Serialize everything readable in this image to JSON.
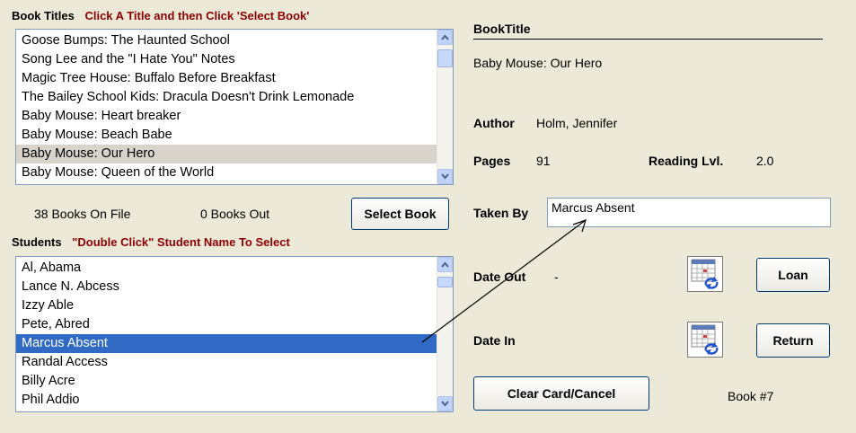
{
  "book_titles": {
    "heading": "Book Titles",
    "instruction": "Click A Title and then Click 'Select Book'",
    "items": [
      "Goose Bumps: The Haunted School",
      "Song Lee and the \"I Hate You\" Notes",
      "Magic Tree House: Buffalo Before Breakfast",
      "The Bailey School Kids: Dracula Doesn't Drink Lemonade",
      "Baby Mouse: Heart breaker",
      "Baby Mouse: Beach Babe",
      "Baby Mouse: Our Hero",
      "Baby Mouse: Queen of the World"
    ],
    "selected_index": 6
  },
  "counts": {
    "books_on_file": "38 Books On File",
    "books_out": "0 Books Out"
  },
  "select_book_label": "Select Book",
  "students": {
    "heading": "Students",
    "instruction": "\"Double Click\" Student Name To Select",
    "items": [
      "Al, Abama",
      "Lance N. Abcess",
      "Izzy Able",
      "Pete, Abred",
      "Marcus Absent",
      "Randal Access",
      "Billy Acre",
      "Phil Addio"
    ],
    "selected_index": 4
  },
  "details": {
    "header": "BookTitle",
    "title_value": "Baby Mouse: Our Hero",
    "author_label": "Author",
    "author_value": "Holm, Jennifer",
    "pages_label": "Pages",
    "pages_value": "91",
    "reading_label": "Reading Lvl.",
    "reading_value": "2.0",
    "taken_by_label": "Taken By",
    "taken_by_value": "Marcus Absent",
    "date_out_label": "Date Out",
    "date_out_value": "-",
    "date_in_label": "Date In",
    "loan_label": "Loan",
    "return_label": "Return",
    "clear_label": "Clear Card/Cancel",
    "book_number": "Book #7"
  },
  "icons": {
    "calendar_out": "calendar-icon",
    "calendar_in": "calendar-icon"
  }
}
